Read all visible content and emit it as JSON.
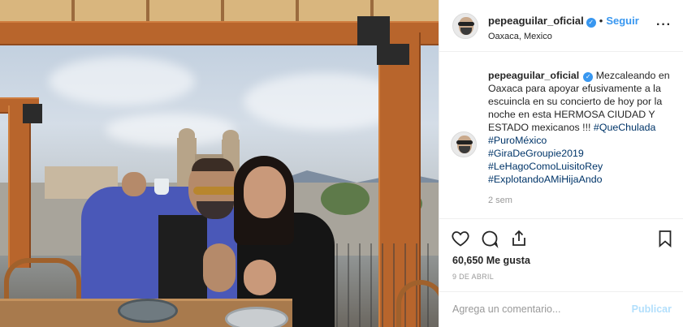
{
  "header": {
    "username": "pepeaguilar_oficial",
    "separator": "•",
    "follow_label": "Seguir",
    "location": "Oaxaca, Mexico",
    "more_label": "···"
  },
  "caption": {
    "username": "pepeaguilar_oficial",
    "text": "Mezcaleando en Oaxaca para apoyar efusivamente a la escuincla en su concierto de hoy por la noche en esta HERMOSA CIUDAD Y ESTADO mexicanos !!!",
    "hashtags": [
      "#QueChulada",
      "#PuroMéxico",
      "#GiraDeGroupie2019",
      "#LeHagoComoLuisitoRey",
      "#ExplotandoAMiHijaAndo"
    ],
    "time": "2 sem"
  },
  "actions": {
    "like_icon": "heart-icon",
    "comment_icon": "comment-icon",
    "share_icon": "share-icon",
    "save_icon": "bookmark-icon",
    "likes": "60,650",
    "likes_label": "Me gusta",
    "date": "9 DE ABRIL"
  },
  "comment_box": {
    "placeholder": "Agrega un comentario...",
    "post_label": "Publicar"
  },
  "colors": {
    "accent": "#3897f0",
    "hashtag": "#003569",
    "muted": "#999999",
    "post_disabled": "#b2dffc"
  }
}
